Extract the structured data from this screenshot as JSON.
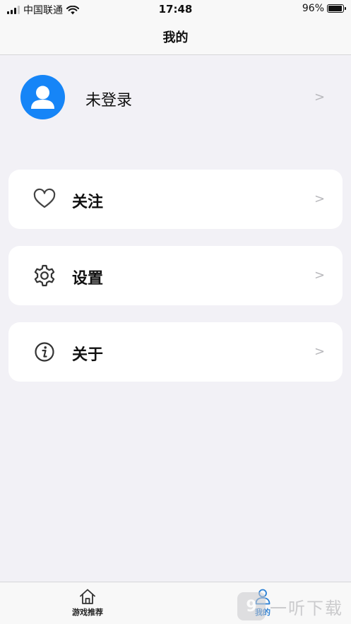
{
  "status_bar": {
    "carrier": "中国联通",
    "time": "17:48",
    "battery": "96%",
    "battery_level": 0.96
  },
  "nav": {
    "title": "我的"
  },
  "profile": {
    "name": "未登录",
    "chevron": ">"
  },
  "menu": [
    {
      "label": "关注",
      "icon": "heart-icon",
      "chevron": ">"
    },
    {
      "label": "设置",
      "icon": "gear-icon",
      "chevron": ">"
    },
    {
      "label": "关于",
      "icon": "info-icon",
      "chevron": ">"
    }
  ],
  "tabs": [
    {
      "label": "游戏推荐",
      "icon": "home-icon",
      "active": false
    },
    {
      "label": "我的",
      "icon": "person-icon",
      "active": true
    }
  ],
  "watermark": {
    "logo": "9",
    "text": "一听下载"
  },
  "colors": {
    "accent": "#1685f7",
    "tab_active": "#2a7fd4",
    "background": "#f2f1f6"
  }
}
